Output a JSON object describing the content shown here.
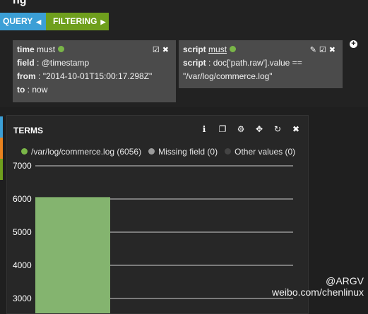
{
  "header": {
    "title_cut": "ng"
  },
  "tabs": [
    {
      "label": "QUERY",
      "color": "#3b9fd6"
    },
    {
      "label": "FILTERING",
      "color": "#6f9f1d"
    }
  ],
  "filters": [
    {
      "name": "time",
      "mode": "must",
      "rows": [
        {
          "key": "field",
          "value": "@timestamp"
        },
        {
          "key": "from",
          "value": "\"2014-10-01T15:00:17.298Z\""
        },
        {
          "key": "to",
          "value": "now"
        }
      ]
    },
    {
      "name": "script",
      "mode": "must",
      "script_key": "script",
      "script_line1": "doc['path.raw'].value ==",
      "script_line2": "\"/var/log/commerce.log\""
    }
  ],
  "panel": {
    "title": "TERMS",
    "legend": [
      {
        "label": "/var/log/commerce.log (6056)",
        "color": "#7ab648"
      },
      {
        "label": "Missing field (0)",
        "color": "#9a9a9a"
      },
      {
        "label": "Other values (0)",
        "color": "#444444"
      }
    ]
  },
  "chart_data": {
    "type": "bar",
    "categories": [
      "/var/log/commerce.log"
    ],
    "values": [
      6056
    ],
    "ylim": [
      3000,
      7000
    ],
    "yticks": [
      3000,
      4000,
      5000,
      6000,
      7000
    ],
    "grid": true,
    "bar_color": "#84b46f"
  },
  "watermark": {
    "line1": "@ARGV",
    "line2": "weibo.com/chenlinux"
  }
}
